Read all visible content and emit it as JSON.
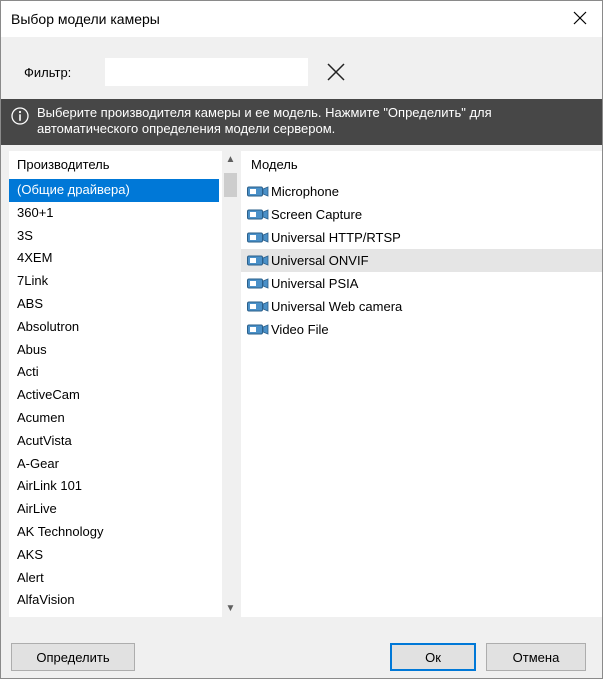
{
  "window": {
    "title": "Выбор модели камеры"
  },
  "filter": {
    "label": "Фильтр:",
    "value": ""
  },
  "info": {
    "text": "Выберите производителя камеры и ее модель. Нажмите \"Определить\" для автоматического определения модели сервером."
  },
  "manufacturers": {
    "header": "Производитель",
    "selected": "(Общие драйвера)",
    "items": [
      "(Общие драйвера)",
      "360+1",
      "3S",
      "4XEM",
      "7Link",
      "ABS",
      "Absolutron",
      "Abus",
      "Acti",
      "ActiveCam",
      "Acumen",
      "AcutVista",
      "A-Gear",
      "AirLink 101",
      "AirLive",
      "AK Technology",
      "AKS",
      "Alert",
      "AlfaVision"
    ]
  },
  "models": {
    "header": "Модель",
    "items": [
      "Microphone",
      "Screen Capture",
      "Universal HTTP/RTSP",
      "Universal ONVIF",
      "Universal PSIA",
      "Universal Web camera",
      "Video File"
    ],
    "highlighted": "Universal ONVIF"
  },
  "buttons": {
    "detect": "Определить",
    "ok": "Ок",
    "cancel": "Отмена"
  },
  "colors": {
    "selection": "#0078d7",
    "info_bg": "#474747",
    "hover_row": "#e5e5e5"
  }
}
